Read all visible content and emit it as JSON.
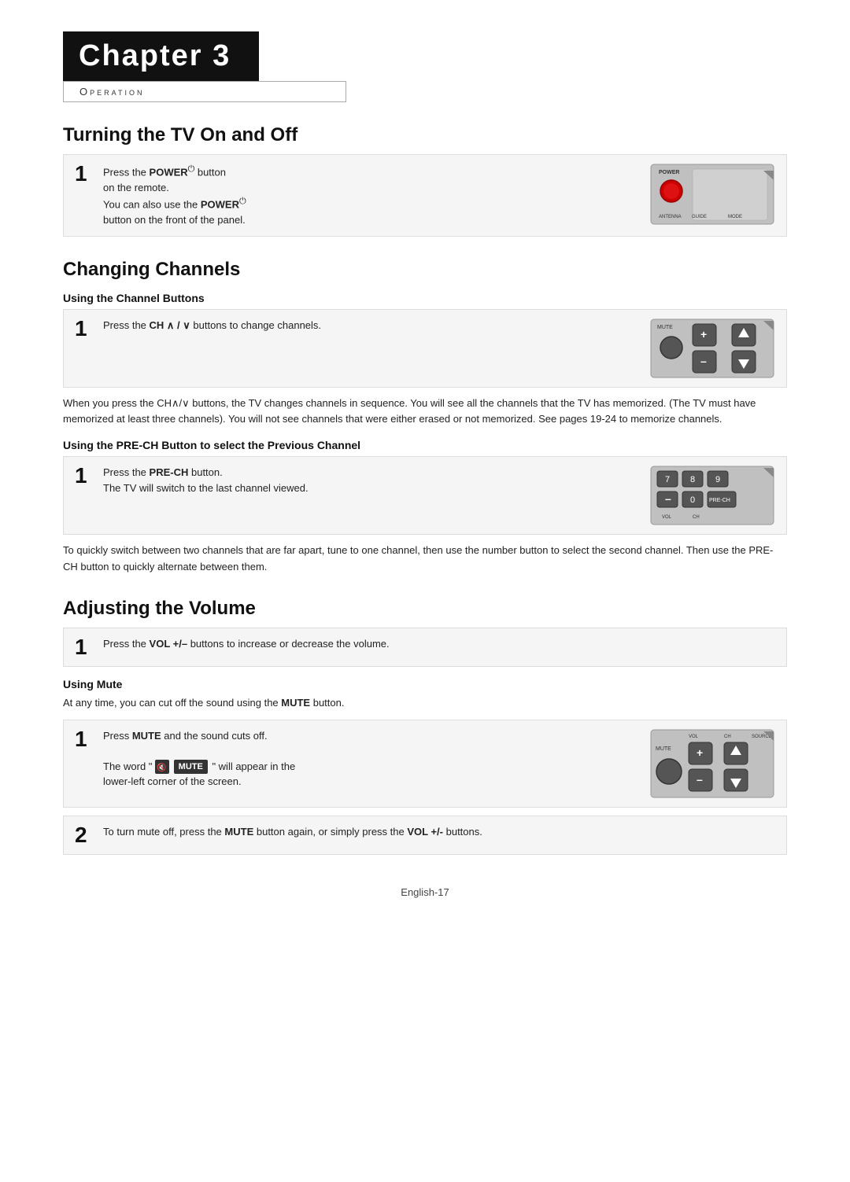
{
  "chapter": {
    "title": "Chapter 3",
    "subtitle": "Operation"
  },
  "sections": {
    "turning": {
      "title": "Turning the TV On and Off",
      "step1": {
        "number": "1",
        "lines": [
          "Press the ",
          "POWER",
          " button",
          "on the remote.",
          "You can also use the ",
          "POWER",
          "",
          "button on the front of the panel."
        ]
      }
    },
    "changing": {
      "title": "Changing Channels",
      "sub1": {
        "subtitle": "Using the Channel Buttons",
        "step1": {
          "number": "1",
          "text_pre": "Press the ",
          "bold": "CH ∧ / ∨",
          "text_post": " buttons to change channels."
        }
      },
      "body": "When you press the CH∧/∨ buttons, the TV changes channels in sequence. You will see all the channels that the TV has memorized. (The TV must have memorized at least three channels). You will not see channels that were either erased or not memorized. See pages 19-24 to memorize channels.",
      "sub2": {
        "subtitle": "Using the PRE-CH Button to select the Previous Channel",
        "step1": {
          "number": "1",
          "line1": "Press the ",
          "bold1": "PRE-CH",
          "line2": " button.",
          "line3": "The TV will switch to the last channel viewed."
        }
      },
      "body2": "To quickly switch between two channels that are far apart, tune to one channel, then use the number button to select the second channel. Then use the PRE-CH button to quickly alternate between them."
    },
    "volume": {
      "title": "Adjusting the Volume",
      "step1": {
        "number": "1",
        "text_pre": "Press the ",
        "bold": "VOL +/–",
        "text_post": " buttons to increase or decrease the volume."
      },
      "mute": {
        "subtitle": "Using Mute",
        "intro_pre": "At any time, you can cut off the sound using the ",
        "intro_bold": "MUTE",
        "intro_post": " button.",
        "step1": {
          "number": "1",
          "line1": "Press ",
          "bold1": "MUTE",
          "line2": " and the sound cuts off.",
          "line3_pre": "The word \"",
          "line3_post": "\" will appear in the",
          "line4": "lower-left corner of the screen."
        },
        "step2": {
          "number": "2",
          "text_pre": "To turn mute off, press the ",
          "bold1": "MUTE",
          "text_mid": " button again, or simply press the ",
          "bold2": "VOL +/-",
          "text_post": " buttons."
        }
      }
    }
  },
  "footer": {
    "text": "English-17"
  }
}
